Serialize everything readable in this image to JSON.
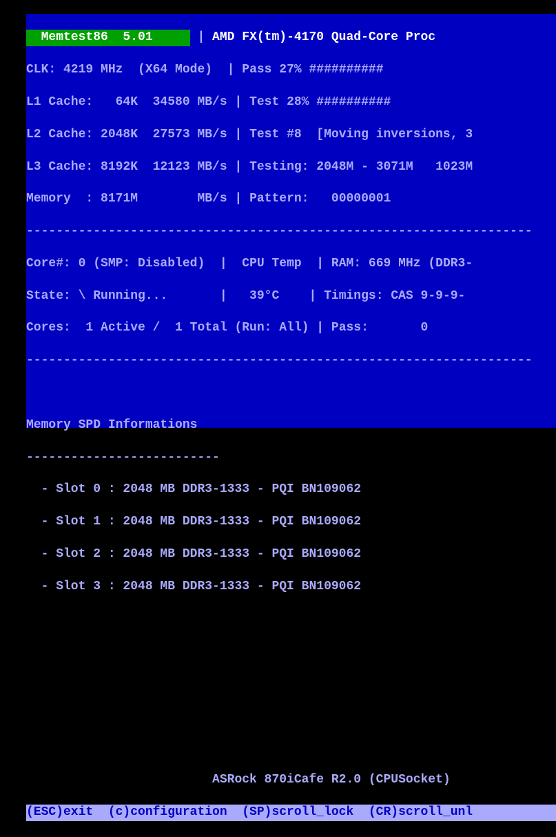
{
  "title": "  Memtest86  5.01     ",
  "cpu": " AMD FX(tm)-4170 Quad-Core Proc",
  "clk": "CLK: 4219 MHz  (X64 Mode)  ",
  "pass": " Pass 27% ",
  "passbar": "##########",
  "l1": "L1 Cache:   64K  34580 MB/s ",
  "test": " Test 28% ",
  "testbar": "##########",
  "l2": "L2 Cache: 2048K  27573 MB/s ",
  "testnum": " Test #8  [Moving inversions, 3",
  "l3": "L3 Cache: 8192K  12123 MB/s ",
  "testing": " Testing: 2048M - 3071M   1023M",
  "mem": "Memory  : 8171M        MB/s ",
  "pattern": " Pattern:   00000001",
  "dash1": "--------------------------------------------------------------------",
  "core": "Core#: 0 (SMP: Disabled)  ",
  "cputemp_h": "  CPU Temp  ",
  "ram": " RAM: 669 MHz (DDR3-",
  "state": "State: \\ Running...      ",
  "cputemp_v": "   39°C    ",
  "timings": " Timings: CAS 9-9-9-",
  "cores": "Cores:  1 Active /  1 Total (Run: All) ",
  "passn": " Pass:       0",
  "dash2": "--------------------------------------------------------------------",
  "spd_title": "Memory SPD Informations",
  "spd_dash": "--------------------------",
  "slot0": "  - Slot 0 : 2048 MB DDR3-1333 - PQI BN109062",
  "slot1": "  - Slot 1 : 2048 MB DDR3-1333 - PQI BN109062",
  "slot2": "  - Slot 2 : 2048 MB DDR3-1333 - PQI BN109062",
  "slot3": "  - Slot 3 : 2048 MB DDR3-1333 - PQI BN109062",
  "mobo": "                         ASRock 870iCafe R2.0 (CPUSocket)",
  "footer": "(ESC)exit  (c)configuration  (SP)scroll_lock  (CR)scroll_unl"
}
